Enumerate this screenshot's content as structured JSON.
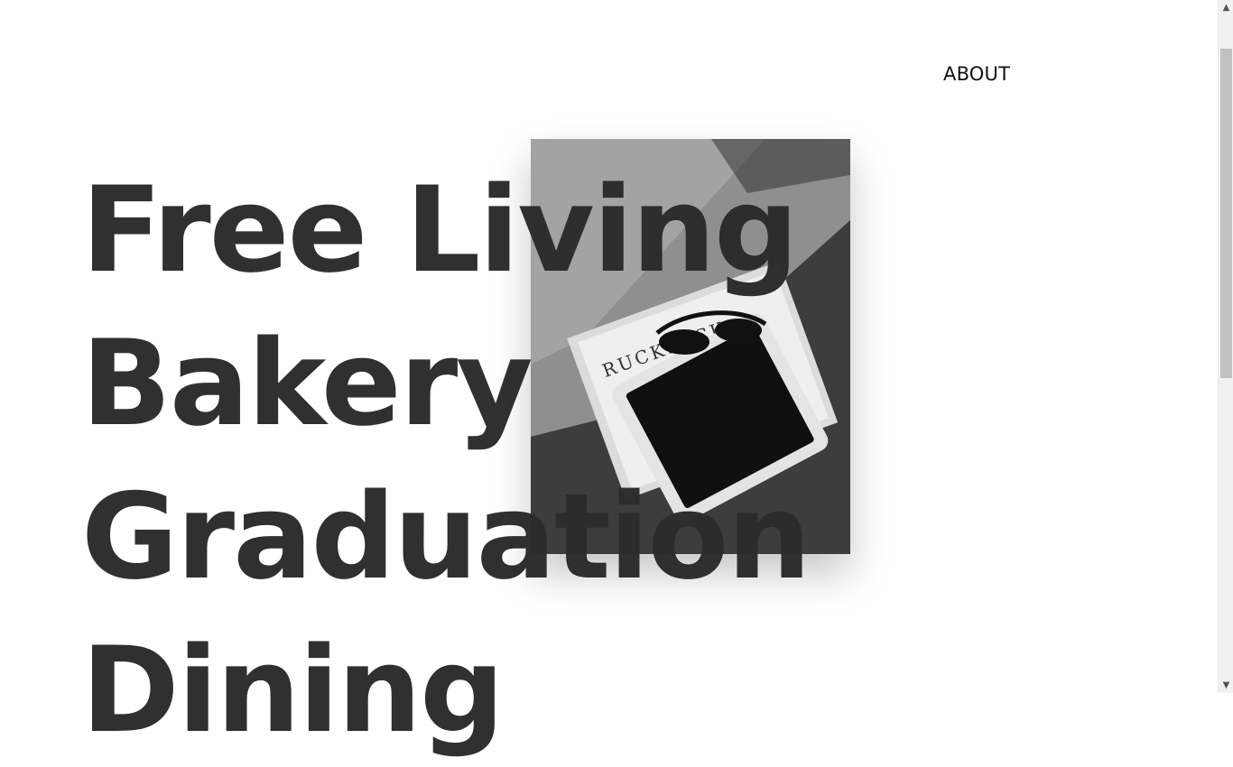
{
  "nav": {
    "about_label": "ABOUT"
  },
  "hero": {
    "words": [
      "Free Living",
      "Bakery",
      "Graduation",
      "Dining"
    ],
    "image": {
      "magazine_text": "RUCKSACK"
    }
  },
  "scrollbar": {
    "up_arrow": "▲",
    "down_arrow": "▼"
  }
}
